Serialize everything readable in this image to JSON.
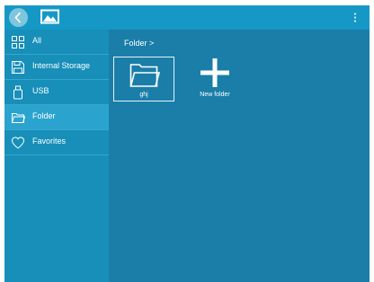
{
  "colors": {
    "topbar": "#1698c6",
    "sidebar": "#178fb9",
    "sidebar_selected": "#2aa4cf",
    "main": "#1a7ea8",
    "text": "#ffffff"
  },
  "topbar": {
    "back_icon": "chevron-left-icon",
    "gallery_icon": "image-icon",
    "menu_icon": "more-vert-icon"
  },
  "sidebar": {
    "items": [
      {
        "label": "All",
        "icon": "grid-icon",
        "selected": false
      },
      {
        "label": "Internal Storage",
        "icon": "save-icon",
        "selected": false
      },
      {
        "label": "USB",
        "icon": "usb-icon",
        "selected": false
      },
      {
        "label": "Folder",
        "icon": "folder-icon",
        "selected": true
      },
      {
        "label": "Favorites",
        "icon": "heart-icon",
        "selected": false
      }
    ]
  },
  "main": {
    "breadcrumb": "Folder >",
    "items": [
      {
        "label": "ghj",
        "icon": "folder-icon"
      },
      {
        "label": "New folder",
        "icon": "plus-icon"
      }
    ]
  }
}
